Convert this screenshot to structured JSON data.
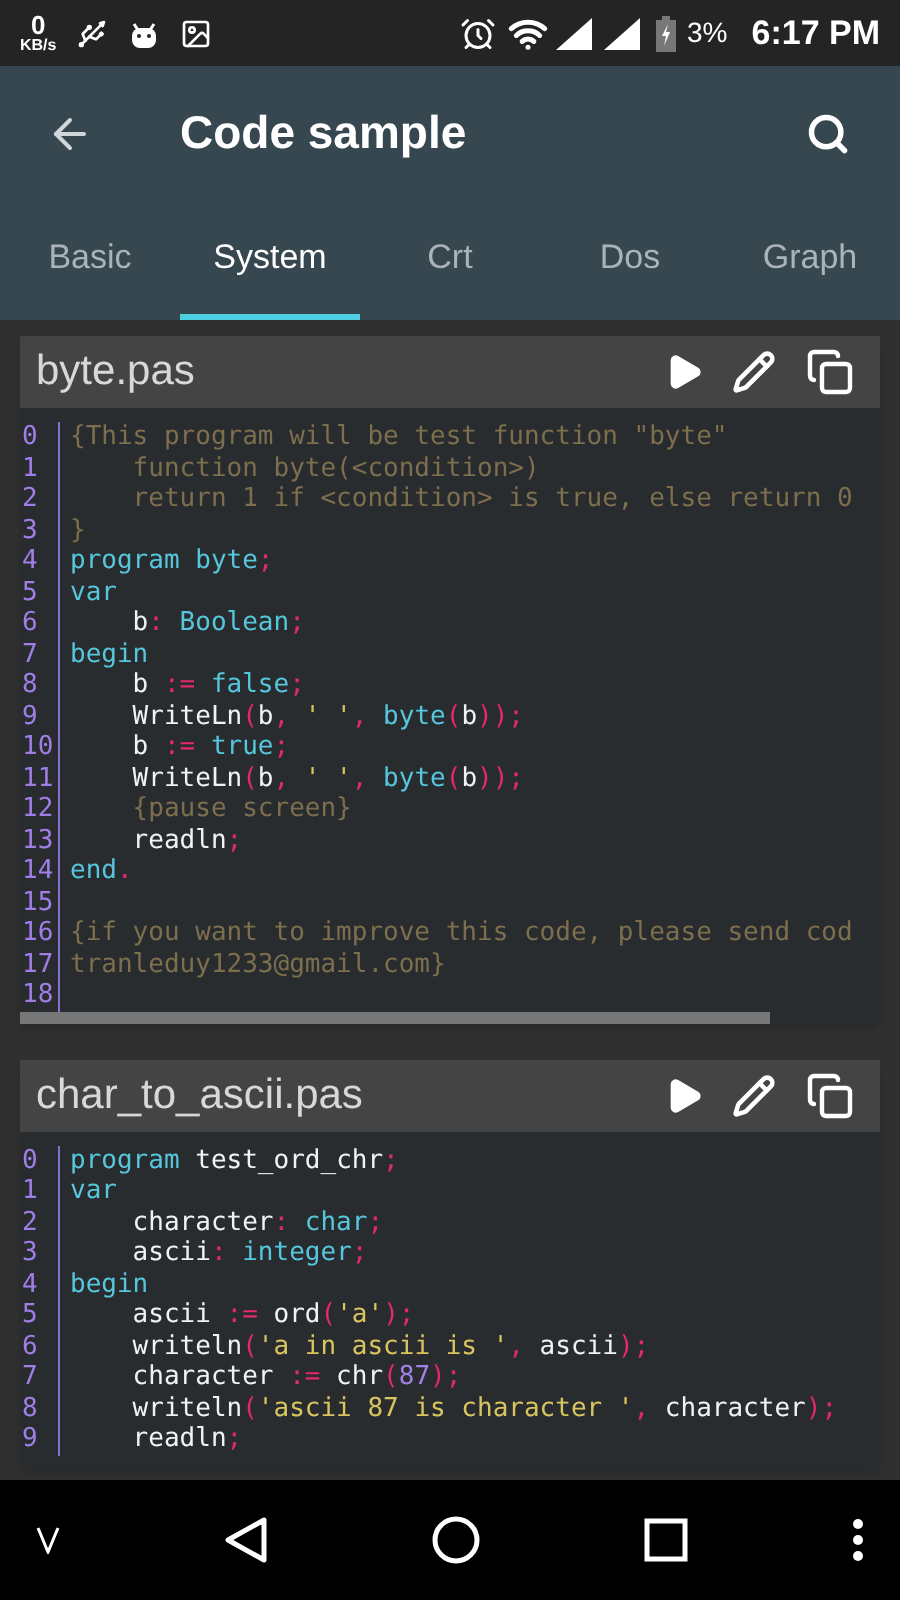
{
  "status_bar": {
    "net_speed": "0",
    "net_unit": "KB/s",
    "battery": "3%",
    "time": "6:17 PM"
  },
  "app_bar": {
    "title": "Code sample"
  },
  "tabs": [
    {
      "label": "Basic",
      "selected": false
    },
    {
      "label": "System",
      "selected": true
    },
    {
      "label": "Crt",
      "selected": false
    },
    {
      "label": "Dos",
      "selected": false
    },
    {
      "label": "Graph",
      "selected": false
    }
  ],
  "files": [
    {
      "name": "byte.pas",
      "lines": [
        {
          "number": "0",
          "tokens": [
            {
              "text": "{This program will be test function \"byte\"",
              "kind": "comment"
            }
          ]
        },
        {
          "number": "1",
          "tokens": [
            {
              "text": "    function byte(<condition>)",
              "kind": "comment"
            }
          ]
        },
        {
          "number": "2",
          "tokens": [
            {
              "text": "    return 1 if <condition> is true, else return 0",
              "kind": "comment"
            }
          ]
        },
        {
          "number": "3",
          "tokens": [
            {
              "text": "}",
              "kind": "comment"
            }
          ]
        },
        {
          "number": "4",
          "tokens": [
            {
              "text": "program byte",
              "kind": "keyword"
            },
            {
              "text": ";",
              "kind": "punct"
            }
          ]
        },
        {
          "number": "5",
          "tokens": [
            {
              "text": "var",
              "kind": "keyword"
            }
          ]
        },
        {
          "number": "6",
          "tokens": [
            {
              "text": "    b",
              "kind": "ident"
            },
            {
              "text": ":",
              "kind": "punct"
            },
            {
              "text": " Boolean",
              "kind": "keyword"
            },
            {
              "text": ";",
              "kind": "punct"
            }
          ]
        },
        {
          "number": "7",
          "tokens": [
            {
              "text": "begin",
              "kind": "keyword"
            }
          ]
        },
        {
          "number": "8",
          "tokens": [
            {
              "text": "    b ",
              "kind": "ident"
            },
            {
              "text": ":=",
              "kind": "punct"
            },
            {
              "text": " false",
              "kind": "keyword"
            },
            {
              "text": ";",
              "kind": "punct"
            }
          ]
        },
        {
          "number": "9",
          "tokens": [
            {
              "text": "    WriteLn",
              "kind": "ident"
            },
            {
              "text": "(",
              "kind": "punct"
            },
            {
              "text": "b",
              "kind": "ident"
            },
            {
              "text": ",",
              "kind": "punct"
            },
            {
              "text": " ' '",
              "kind": "string"
            },
            {
              "text": ",",
              "kind": "punct"
            },
            {
              "text": " byte",
              "kind": "keyword"
            },
            {
              "text": "(",
              "kind": "punct"
            },
            {
              "text": "b",
              "kind": "ident"
            },
            {
              "text": "));",
              "kind": "punct"
            }
          ]
        },
        {
          "number": "10",
          "tokens": [
            {
              "text": "    b ",
              "kind": "ident"
            },
            {
              "text": ":=",
              "kind": "punct"
            },
            {
              "text": " true",
              "kind": "keyword"
            },
            {
              "text": ";",
              "kind": "punct"
            }
          ]
        },
        {
          "number": "11",
          "tokens": [
            {
              "text": "    WriteLn",
              "kind": "ident"
            },
            {
              "text": "(",
              "kind": "punct"
            },
            {
              "text": "b",
              "kind": "ident"
            },
            {
              "text": ",",
              "kind": "punct"
            },
            {
              "text": " ' '",
              "kind": "string"
            },
            {
              "text": ",",
              "kind": "punct"
            },
            {
              "text": " byte",
              "kind": "keyword"
            },
            {
              "text": "(",
              "kind": "punct"
            },
            {
              "text": "b",
              "kind": "ident"
            },
            {
              "text": "));",
              "kind": "punct"
            }
          ]
        },
        {
          "number": "12",
          "tokens": [
            {
              "text": "    {pause screen}",
              "kind": "comment"
            }
          ]
        },
        {
          "number": "13",
          "tokens": [
            {
              "text": "    readln",
              "kind": "ident"
            },
            {
              "text": ";",
              "kind": "punct"
            }
          ]
        },
        {
          "number": "14",
          "tokens": [
            {
              "text": "end",
              "kind": "keyword"
            },
            {
              "text": ".",
              "kind": "punct"
            }
          ]
        },
        {
          "number": "15"
        },
        {
          "number": "16",
          "tokens": [
            {
              "text": "{if you want to improve this code, please send cod",
              "kind": "comment"
            }
          ]
        },
        {
          "number": "17",
          "tokens": [
            {
              "text": "tranleduy1233@gmail.com}",
              "kind": "comment"
            }
          ]
        },
        {
          "number": "18"
        }
      ]
    },
    {
      "name": "char_to_ascii.pas",
      "lines": [
        {
          "number": "0",
          "tokens": [
            {
              "text": "program",
              "kind": "keyword"
            },
            {
              "text": " test_ord_chr",
              "kind": "ident"
            },
            {
              "text": ";",
              "kind": "punct"
            }
          ]
        },
        {
          "number": "1",
          "tokens": [
            {
              "text": "var",
              "kind": "keyword"
            }
          ]
        },
        {
          "number": "2",
          "tokens": [
            {
              "text": "    character",
              "kind": "ident"
            },
            {
              "text": ":",
              "kind": "punct"
            },
            {
              "text": " char",
              "kind": "keyword"
            },
            {
              "text": ";",
              "kind": "punct"
            }
          ]
        },
        {
          "number": "3",
          "tokens": [
            {
              "text": "    ascii",
              "kind": "ident"
            },
            {
              "text": ":",
              "kind": "punct"
            },
            {
              "text": " integer",
              "kind": "keyword"
            },
            {
              "text": ";",
              "kind": "punct"
            }
          ]
        },
        {
          "number": "4",
          "tokens": [
            {
              "text": "begin",
              "kind": "keyword"
            }
          ]
        },
        {
          "number": "5",
          "tokens": [
            {
              "text": "    ascii ",
              "kind": "ident"
            },
            {
              "text": ":=",
              "kind": "punct"
            },
            {
              "text": " ord",
              "kind": "ident"
            },
            {
              "text": "(",
              "kind": "punct"
            },
            {
              "text": "'a'",
              "kind": "string"
            },
            {
              "text": ");",
              "kind": "punct"
            }
          ]
        },
        {
          "number": "6",
          "tokens": [
            {
              "text": "    writeln",
              "kind": "ident"
            },
            {
              "text": "(",
              "kind": "punct"
            },
            {
              "text": "'a in ascii is '",
              "kind": "string"
            },
            {
              "text": ",",
              "kind": "punct"
            },
            {
              "text": " ascii",
              "kind": "ident"
            },
            {
              "text": ");",
              "kind": "punct"
            }
          ]
        },
        {
          "number": "7",
          "tokens": [
            {
              "text": "    character ",
              "kind": "ident"
            },
            {
              "text": ":=",
              "kind": "punct"
            },
            {
              "text": " chr",
              "kind": "ident"
            },
            {
              "text": "(",
              "kind": "punct"
            },
            {
              "text": "87",
              "kind": "number"
            },
            {
              "text": ");",
              "kind": "punct"
            }
          ]
        },
        {
          "number": "8",
          "tokens": [
            {
              "text": "    writeln",
              "kind": "ident"
            },
            {
              "text": "(",
              "kind": "punct"
            },
            {
              "text": "'ascii 87 is character '",
              "kind": "string"
            },
            {
              "text": ",",
              "kind": "punct"
            },
            {
              "text": " character",
              "kind": "ident"
            },
            {
              "text": ");",
              "kind": "punct"
            }
          ]
        },
        {
          "number": "9",
          "tokens": [
            {
              "text": "    readln",
              "kind": "ident"
            },
            {
              "text": ";",
              "kind": "punct"
            }
          ]
        }
      ]
    }
  ]
}
